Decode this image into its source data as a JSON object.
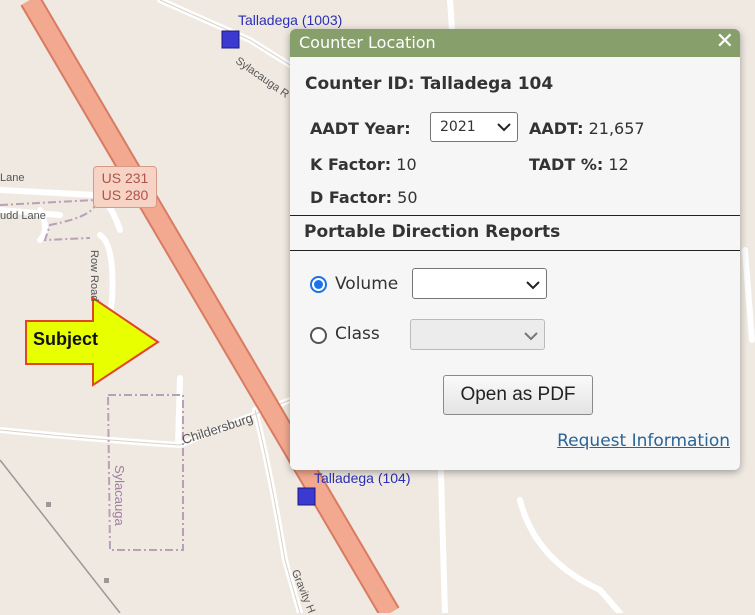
{
  "map": {
    "counters": [
      {
        "label": "Talladega (1003)"
      },
      {
        "label": "Talladega (104)"
      }
    ],
    "road_labels": {
      "sylacauga_road": "Sylacauga R",
      "lane_1": "Lane",
      "lane_2": "udd Lane",
      "row_road": "Row Road",
      "childersburg": "Childersburg",
      "sylacauga": "Sylacauga",
      "gravity": "Gravity H"
    },
    "shield": {
      "line1": "US 231",
      "line2": "US 280"
    },
    "subject_label": "Subject",
    "colors": {
      "background": "#efe9e1",
      "highway": "#f3a98f",
      "highway_edge": "#d97b63",
      "counter_marker": "#3a3ad0",
      "subject_arrow": "#e8ff00"
    }
  },
  "popup": {
    "title": "Counter Location",
    "close_icon": "close-icon",
    "counter_id": "Counter ID: Talladega 104",
    "aadt_year_label": "AADT Year:",
    "aadt_year_value": "2021",
    "aadt_label": "AADT:",
    "aadt_value": "21,657",
    "k_factor_label": "K Factor:",
    "k_factor_value": "10",
    "tadt_label": "TADT %:",
    "tadt_value": "12",
    "d_factor_label": "D Factor:",
    "d_factor_value": "50",
    "section_title": "Portable Direction Reports",
    "volume_label": "Volume",
    "volume_selected": true,
    "class_label": "Class",
    "class_selected": false,
    "open_pdf_label": "Open as PDF",
    "request_info_label": "Request Information",
    "header_color": "#879f6b"
  }
}
